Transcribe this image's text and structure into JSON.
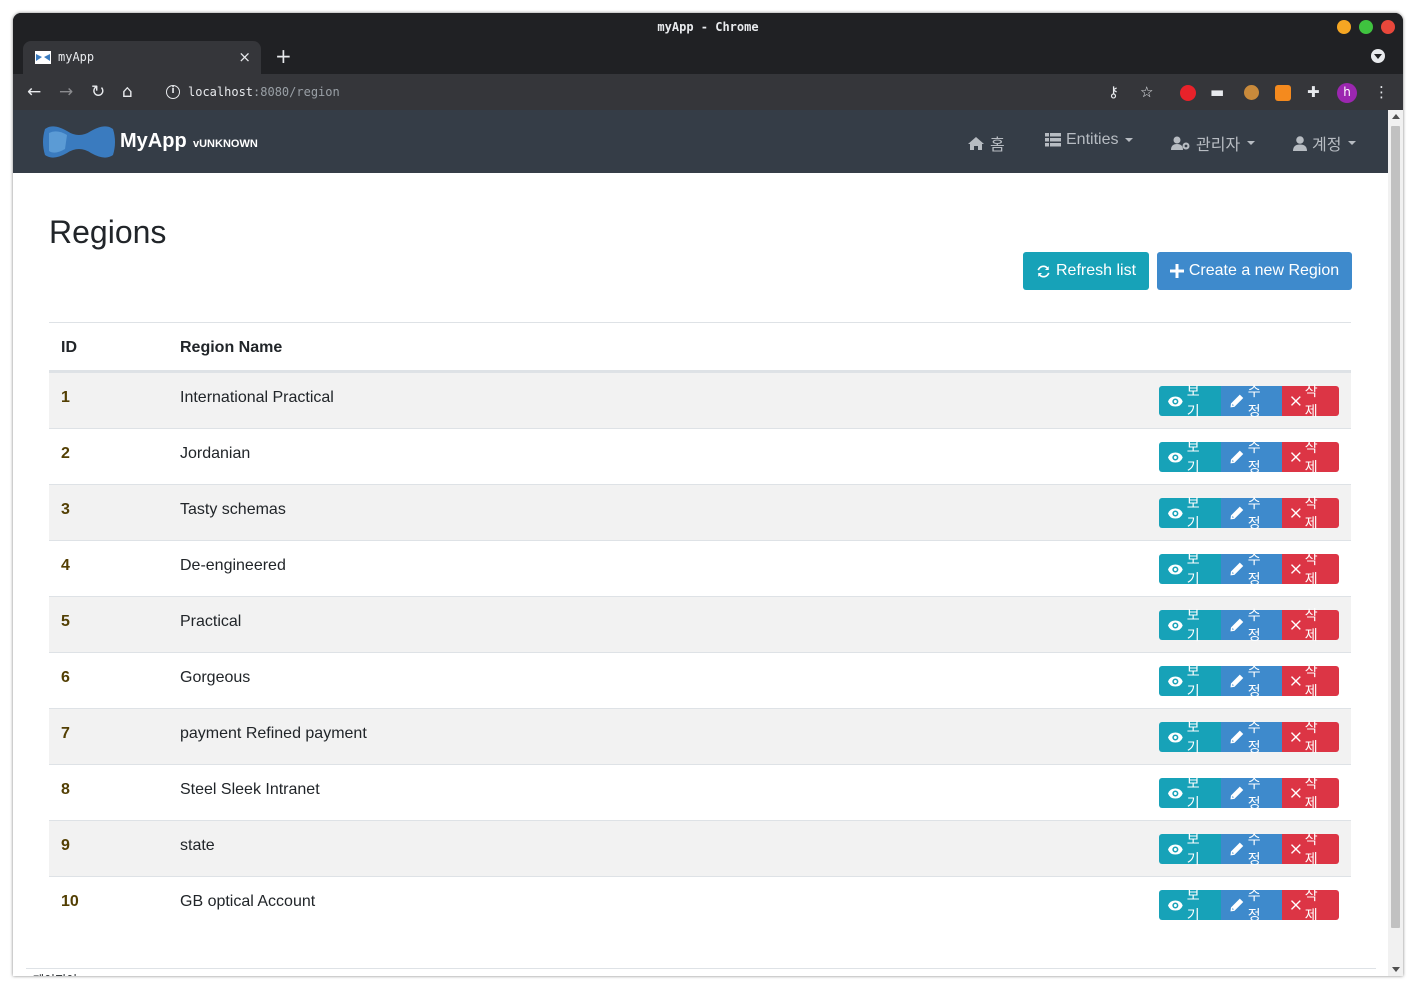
{
  "browser": {
    "window_title": "myApp - Chrome",
    "tab_title": "myApp",
    "tab_close": "×",
    "new_tab": "+",
    "url_host": "localhost",
    "url_rest": ":8080/region",
    "profile_initial": "h"
  },
  "navbar": {
    "brand_title": "MyApp",
    "brand_version": "vUNKNOWN",
    "items": [
      {
        "label": "홈",
        "icon": "home-icon"
      },
      {
        "label": "Entities",
        "icon": "list-icon",
        "dropdown": true
      },
      {
        "label": "관리자",
        "icon": "users-cog-icon",
        "dropdown": true
      },
      {
        "label": "계정",
        "icon": "user-icon",
        "dropdown": true
      }
    ]
  },
  "page": {
    "title": "Regions",
    "refresh_label": "Refresh list",
    "create_label": "Create a new Region"
  },
  "table": {
    "headers": [
      "ID",
      "Region Name"
    ],
    "rows": [
      {
        "id": "1",
        "name": "International Practical"
      },
      {
        "id": "2",
        "name": "Jordanian"
      },
      {
        "id": "3",
        "name": "Tasty schemas"
      },
      {
        "id": "4",
        "name": "De-engineered"
      },
      {
        "id": "5",
        "name": "Practical"
      },
      {
        "id": "6",
        "name": "Gorgeous"
      },
      {
        "id": "7",
        "name": "payment Refined payment"
      },
      {
        "id": "8",
        "name": "Steel Sleek Intranet"
      },
      {
        "id": "9",
        "name": "state"
      },
      {
        "id": "10",
        "name": "GB optical Account"
      }
    ],
    "actions": {
      "view": "보기",
      "edit": "수정",
      "delete": "삭제"
    }
  },
  "footer": {
    "text": "페이지이"
  },
  "colors": {
    "navbar": "#353d47",
    "info": "#17a2b8",
    "primary": "#3e8acc",
    "danger": "#dc3545"
  }
}
